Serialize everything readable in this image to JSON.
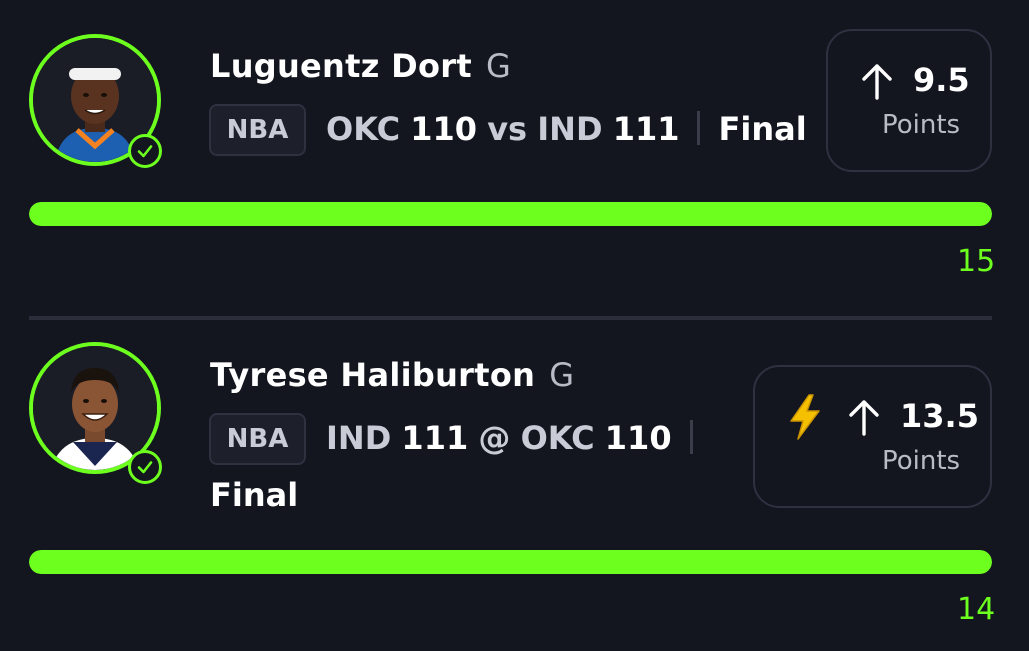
{
  "colors": {
    "accent": "#6dff1e",
    "background": "#13151f",
    "bolt": "#f5c000"
  },
  "picks": [
    {
      "player": "Luguentz Dort",
      "position": "G",
      "league": "NBA",
      "team_a": "OKC",
      "score_a": "110",
      "connector": "vs",
      "team_b": "IND",
      "score_b": "111",
      "status": "Final",
      "direction_icon": "arrow-up-icon",
      "line": "9.5",
      "stat": "Points",
      "actual": "15",
      "progress": 1.0,
      "hit": true
    },
    {
      "player": "Tyrese Haliburton",
      "position": "G",
      "league": "NBA",
      "team_a": "IND",
      "score_a": "111",
      "connector": "@",
      "team_b": "OKC",
      "score_b": "110",
      "status": "Final",
      "boost_icon": "lightning-bolt-icon",
      "direction_icon": "arrow-up-icon",
      "line": "13.5",
      "stat": "Points",
      "actual": "14",
      "progress": 1.0,
      "hit": true
    }
  ]
}
